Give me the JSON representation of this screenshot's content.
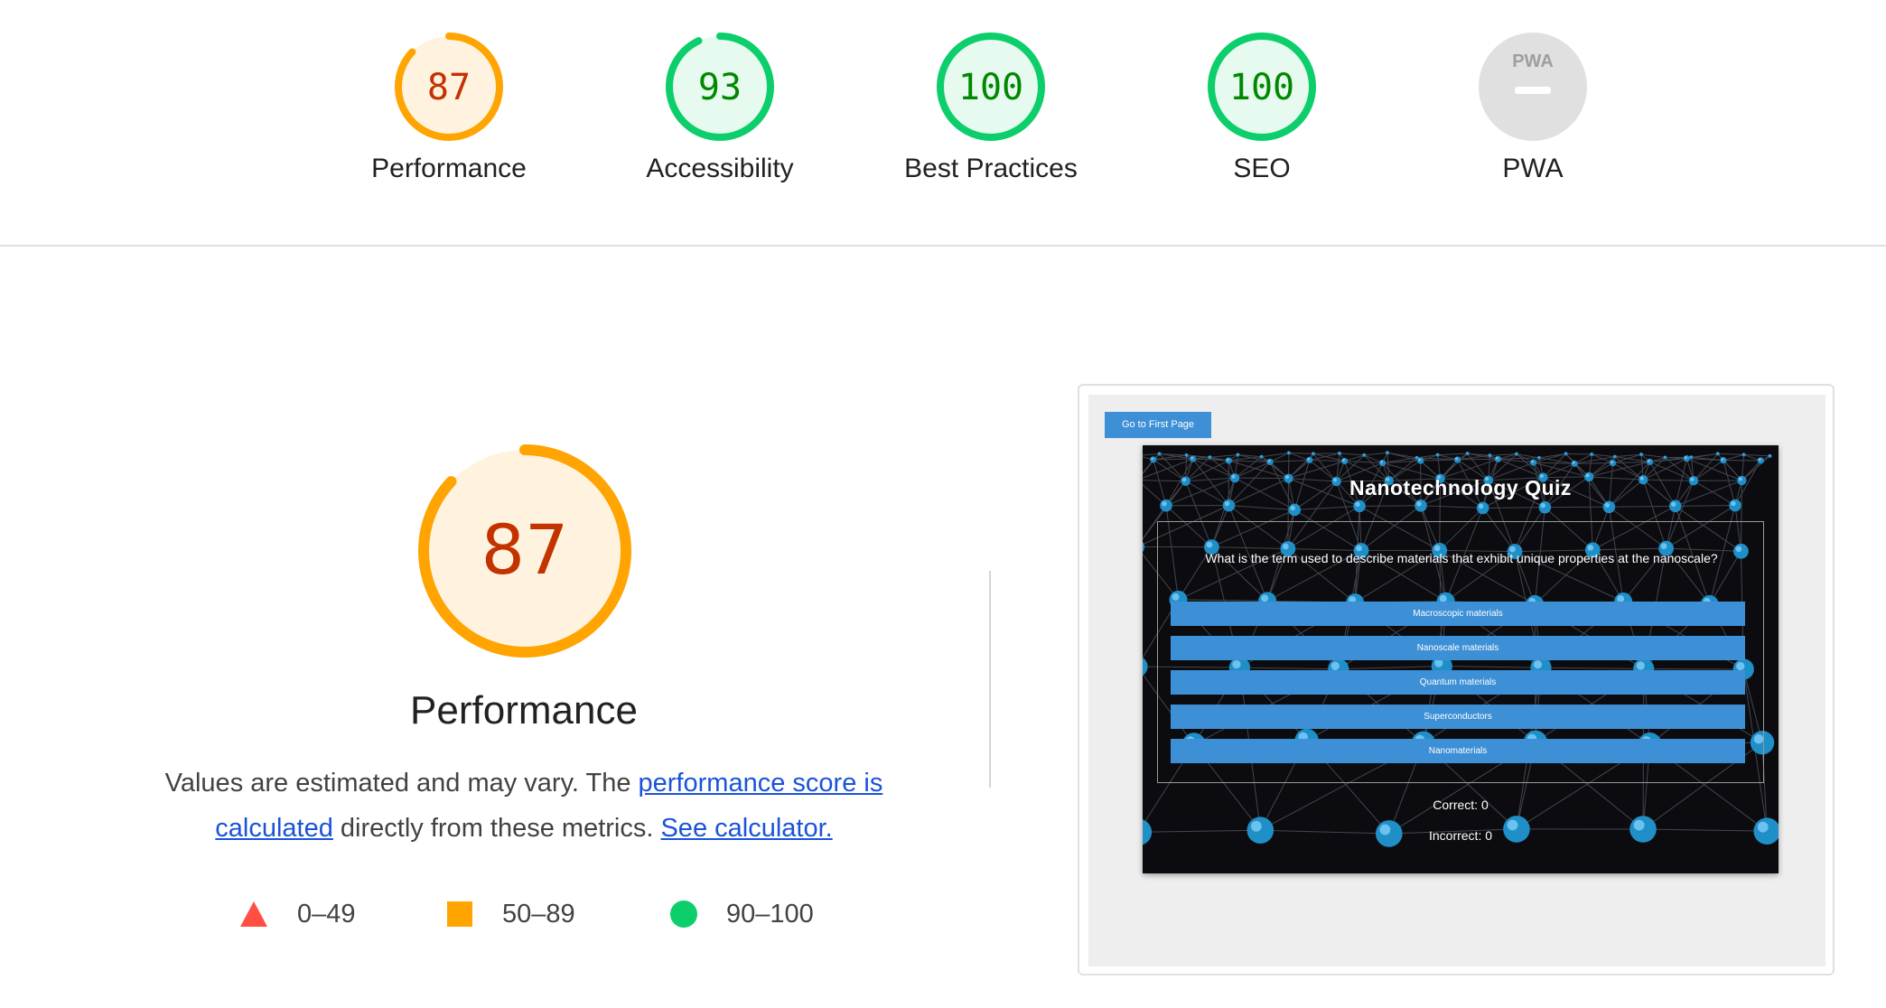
{
  "colors": {
    "average": "#ffa400",
    "average_text": "#c33300",
    "average_fill": "#fff3e0",
    "pass": "#0cce6b",
    "pass_text": "#008800",
    "pass_fill": "#e6faef",
    "fail": "#ff4e42",
    "na_fill": "#e0e0e0",
    "link": "#1a53d8",
    "button_blue": "#3d8fd6"
  },
  "gauges": [
    {
      "score": "87",
      "label": "Performance",
      "value": 87,
      "status": "average"
    },
    {
      "score": "93",
      "label": "Accessibility",
      "value": 93,
      "status": "pass"
    },
    {
      "score": "100",
      "label": "Best Practices",
      "value": 100,
      "status": "pass"
    },
    {
      "score": "100",
      "label": "SEO",
      "value": 100,
      "status": "pass"
    },
    {
      "score": "PWA",
      "label": "PWA",
      "value": null,
      "status": "na"
    }
  ],
  "main_gauge": {
    "score": "87",
    "title": "Performance",
    "value": 87
  },
  "description": {
    "before": "Values are estimated and may vary. The ",
    "link1": "performance score is calculated",
    "middle": " directly from these metrics. ",
    "link2": "See calculator."
  },
  "legend": [
    {
      "icon": "triangle-icon",
      "range": "0–49"
    },
    {
      "icon": "square-icon",
      "range": "50–89"
    },
    {
      "icon": "circle-icon",
      "range": "90–100"
    }
  ],
  "screenshot": {
    "first_page_button": "Go to First Page",
    "quiz_title": "Nanotechnology Quiz",
    "question": "What is the term used to describe materials that exhibit unique properties at the nanoscale?",
    "answers": [
      "Macroscopic materials",
      "Nanoscale materials",
      "Quantum materials",
      "Superconductors",
      "Nanomaterials"
    ],
    "correct": "Correct: 0",
    "incorrect": "Incorrect: 0"
  }
}
